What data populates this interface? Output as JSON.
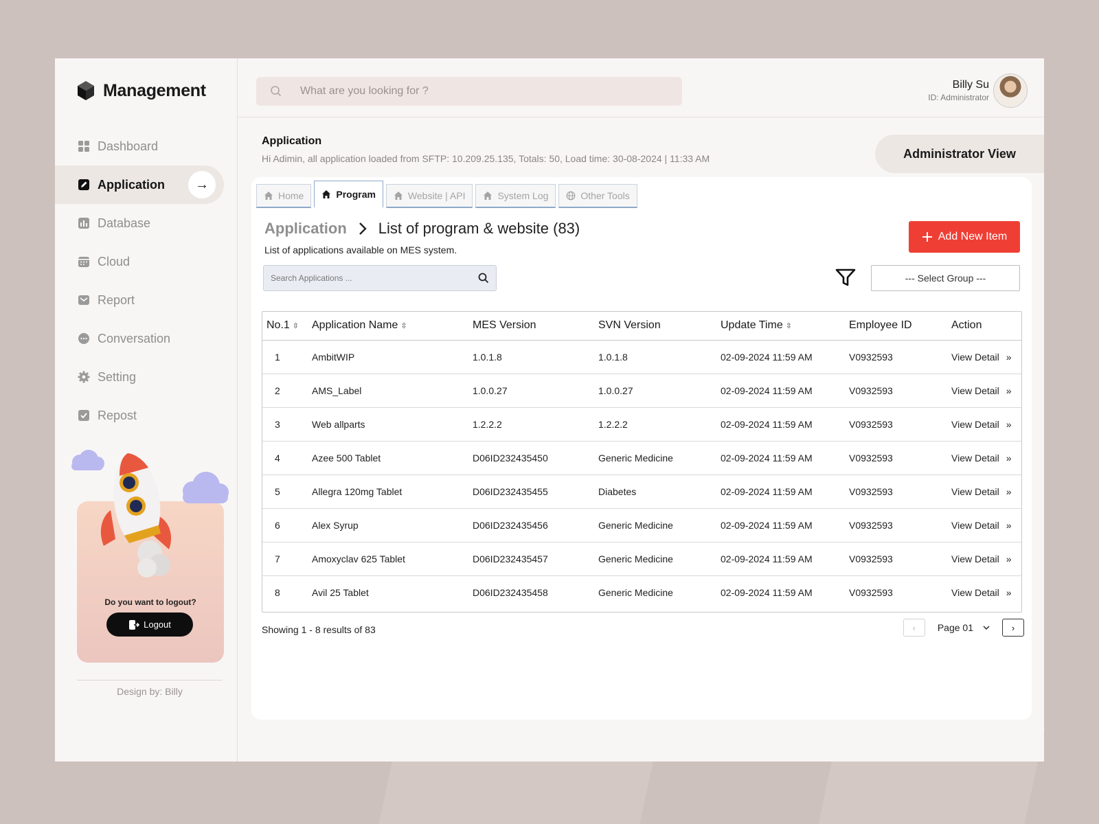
{
  "app": {
    "name": "Management"
  },
  "sidebar": {
    "items": [
      {
        "label": "Dashboard",
        "icon": "grid-icon"
      },
      {
        "label": "Application",
        "icon": "edit-icon",
        "active": true
      },
      {
        "label": "Database",
        "icon": "chart-icon"
      },
      {
        "label": "Cloud",
        "icon": "calendar-icon"
      },
      {
        "label": "Report",
        "icon": "mail-icon"
      },
      {
        "label": "Conversation",
        "icon": "chat-icon"
      },
      {
        "label": "Setting",
        "icon": "gear-icon"
      },
      {
        "label": "Repost",
        "icon": "check-icon"
      }
    ],
    "promo": {
      "question": "Do you want to logout?",
      "logout_label": "Logout"
    },
    "footer": "Design by: Billy"
  },
  "search": {
    "placeholder": "What are you looking for ?"
  },
  "user": {
    "name": "Billy Su",
    "role": "ID: Administrator"
  },
  "info": {
    "title": "Application",
    "subtitle": "Hi Adimin, all application loaded from SFTP: 10.209.25.135, Totals: 50, Load time: 30-08-2024 | 11:33 AM",
    "admin_view_label": "Administrator View"
  },
  "tabs": [
    {
      "label": "Home",
      "icon": "home-icon"
    },
    {
      "label": "Program",
      "icon": "home-icon",
      "active": true
    },
    {
      "label": "Website | API",
      "icon": "home-icon"
    },
    {
      "label": "System Log",
      "icon": "home-icon"
    },
    {
      "label": "Other Tools",
      "icon": "globe-icon"
    }
  ],
  "breadcrumb": {
    "root": "Application",
    "separator": ">",
    "page": "List of program & website (83)"
  },
  "description": "List of applications available on MES system.",
  "add_button": "Add New Item",
  "app_search": {
    "placeholder": "Search Applications ..."
  },
  "select_group": "--- Select Group ---",
  "table": {
    "headers": [
      "No.1",
      "Application Name",
      "MES Version",
      "SVN Version",
      "Update Time",
      "Employee ID",
      "Action"
    ],
    "rows": [
      [
        "1",
        "AmbitWIP",
        "1.0.1.8",
        "1.0.1.8",
        "02-09-2024 11:59 AM",
        "V0932593",
        "View Detail"
      ],
      [
        "2",
        "AMS_Label",
        "1.0.0.27",
        "1.0.0.27",
        "02-09-2024 11:59 AM",
        "V0932593",
        "View Detail"
      ],
      [
        "3",
        "Web allparts",
        "1.2.2.2",
        "1.2.2.2",
        "02-09-2024 11:59 AM",
        "V0932593",
        "View Detail"
      ],
      [
        "4",
        "Azee 500 Tablet",
        "D06ID232435450",
        "Generic Medicine",
        "02-09-2024 11:59 AM",
        "V0932593",
        "View Detail"
      ],
      [
        "5",
        "Allegra 120mg Tablet",
        "D06ID232435455",
        "Diabetes",
        "02-09-2024 11:59 AM",
        "V0932593",
        "View Detail"
      ],
      [
        "6",
        "Alex Syrup",
        "D06ID232435456",
        "Generic Medicine",
        "02-09-2024 11:59 AM",
        "V0932593",
        "View Detail"
      ],
      [
        "7",
        "Amoxyclav 625 Tablet",
        "D06ID232435457",
        "Generic Medicine",
        "02-09-2024 11:59 AM",
        "V0932593",
        "View Detail"
      ],
      [
        "8",
        "Avil 25 Tablet",
        "D06ID232435458",
        "Generic Medicine",
        "02-09-2024 11:59 AM",
        "V0932593",
        "View Detail"
      ]
    ]
  },
  "pagination": {
    "showing": "Showing 1 - 8 results of 83",
    "page_label": "Page 01"
  },
  "colors": {
    "accent": "#ef3f35",
    "sidebar_active": "#ede7e4",
    "background": "#cdc1bd"
  }
}
